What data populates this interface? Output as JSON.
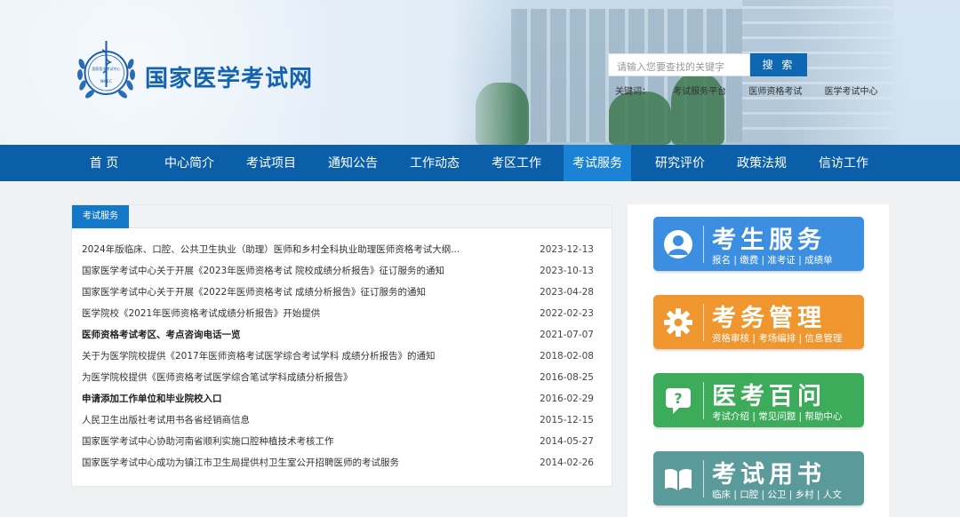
{
  "header": {
    "site_title": "国家医学考试网",
    "logo_text_top": "国家医学考试中心",
    "logo_text_bottom": "NMEC",
    "search_placeholder": "请输入您要查找的关键字",
    "search_button": "搜 索",
    "keywords_label": "关键词：",
    "keywords": [
      "考试服务平台",
      "医师资格考试",
      "医学考试中心"
    ]
  },
  "nav": {
    "items": [
      "首 页",
      "中心简介",
      "考试项目",
      "通知公告",
      "工作动态",
      "考区工作",
      "考试服务",
      "研究评价",
      "政策法规",
      "信访工作"
    ],
    "active_index": 6
  },
  "news_panel": {
    "tab_label": "考试服务",
    "items": [
      {
        "title": "2024年版临床、口腔、公共卫生执业（助理）医师和乡村全科执业助理医师资格考试大纲...",
        "date": "2023-12-13",
        "bold": false
      },
      {
        "title": "国家医学考试中心关于开展《2023年医师资格考试 院校成绩分析报告》征订服务的通知",
        "date": "2023-10-13",
        "bold": false
      },
      {
        "title": "国家医学考试中心关于开展《2022年医师资格考试 成绩分析报告》征订服务的通知",
        "date": "2023-04-28",
        "bold": false
      },
      {
        "title": "医学院校《2021年医师资格考试成绩分析报告》开始提供",
        "date": "2022-02-23",
        "bold": false
      },
      {
        "title": "医师资格考试考区、考点咨询电话一览",
        "date": "2021-07-07",
        "bold": true
      },
      {
        "title": "关于为医学院校提供《2017年医师资格考试医学综合考试学科 成绩分析报告》的通知",
        "date": "2018-02-08",
        "bold": false
      },
      {
        "title": "为医学院校提供《医师资格考试医学综合笔试学科成绩分析报告》",
        "date": "2016-08-25",
        "bold": false
      },
      {
        "title": "申请添加工作单位和毕业院校入口",
        "date": "2016-02-29",
        "bold": true
      },
      {
        "title": "人民卫生出版社考试用书各省经销商信息",
        "date": "2015-12-15",
        "bold": false
      },
      {
        "title": "国家医学考试中心协助河南省顺利实施口腔种植技术考核工作",
        "date": "2014-05-27",
        "bold": false
      },
      {
        "title": "国家医学考试中心成功为镇江市卫生局提供村卫生室公开招聘医师的考试服务",
        "date": "2014-02-26",
        "bold": false
      }
    ]
  },
  "services": [
    {
      "title": "考生服务",
      "sub": "报名 | 缴费 | 准考证 | 成绩单",
      "color": "#3b8ee0",
      "icon": "person-icon"
    },
    {
      "title": "考务管理",
      "sub": "资格审核 | 考场编排 | 信息管理",
      "color": "#f0962e",
      "icon": "gear-icon"
    },
    {
      "title": "医考百问",
      "sub": "考试介绍 | 常见问题 | 帮助中心",
      "color": "#3cab5a",
      "icon": "question-icon"
    },
    {
      "title": "考试用书",
      "sub": "临床 | 口腔 | 公卫 | 乡村 | 人文",
      "color": "#5b9a9a",
      "icon": "book-icon"
    }
  ]
}
